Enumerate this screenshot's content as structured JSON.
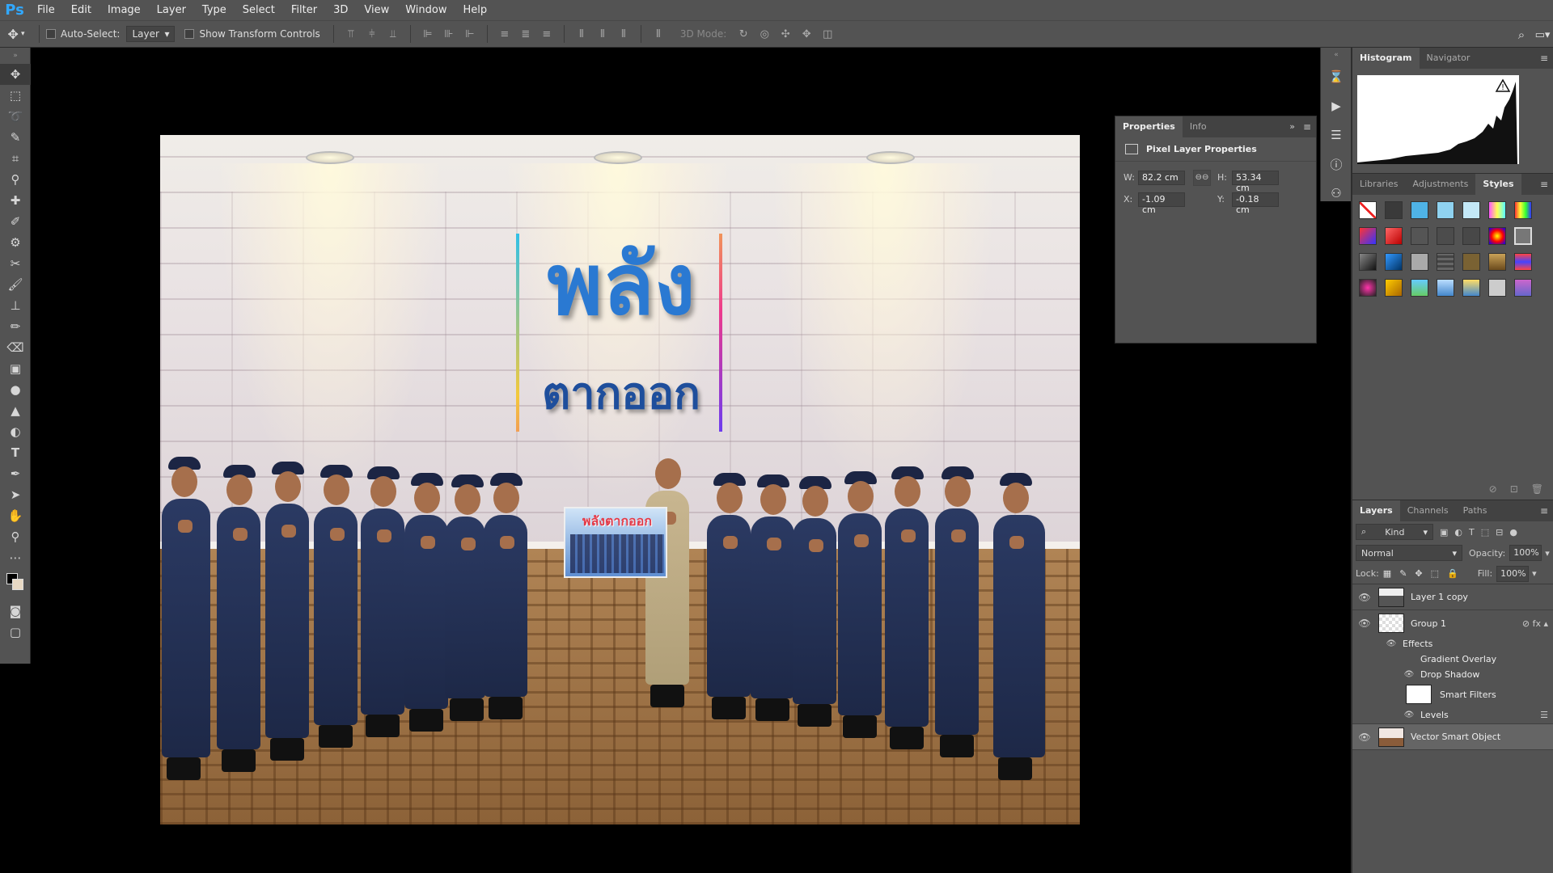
{
  "app": {
    "logo": "Ps"
  },
  "menu": [
    "File",
    "Edit",
    "Image",
    "Layer",
    "Type",
    "Select",
    "Filter",
    "3D",
    "View",
    "Window",
    "Help"
  ],
  "options": {
    "auto_select_label": "Auto-Select:",
    "auto_select_value": "Layer",
    "show_transform_label": "Show Transform Controls",
    "mode_3d_label": "3D Mode:"
  },
  "canvas": {
    "logo_text": "พลัง",
    "logo_sub": "ตากออก",
    "banner_text": "พลังตากออก"
  },
  "properties": {
    "tabs": [
      "Properties",
      "Info"
    ],
    "header": "Pixel Layer Properties",
    "w_label": "W:",
    "w": "82.2 cm",
    "h_label": "H:",
    "h": "53.34 cm",
    "x_label": "X:",
    "x": "-1.09 cm",
    "y_label": "Y:",
    "y": "-0.18 cm"
  },
  "histogram": {
    "tabs": [
      "Histogram",
      "Navigator"
    ]
  },
  "styles": {
    "tabs": [
      "Libraries",
      "Adjustments",
      "Styles"
    ]
  },
  "layers_panel": {
    "tabs": [
      "Layers",
      "Channels",
      "Paths"
    ],
    "kind": "Kind",
    "blend_mode": "Normal",
    "opacity_label": "Opacity:",
    "opacity": "100%",
    "lock_label": "Lock:",
    "fill_label": "Fill:",
    "fill": "100%",
    "layers": [
      {
        "name": "Layer 1 copy"
      },
      {
        "name": "Group 1"
      },
      {
        "name": "Vector Smart Object"
      }
    ],
    "effects": {
      "label": "Effects",
      "gradient_overlay": "Gradient Overlay",
      "drop_shadow": "Drop Shadow",
      "smart_filters": "Smart Filters",
      "levels": "Levels"
    }
  },
  "colors": {
    "panel_bg": "#535353",
    "accent_blue": "#31a8ff",
    "logo_blue": "#2a79d2"
  }
}
